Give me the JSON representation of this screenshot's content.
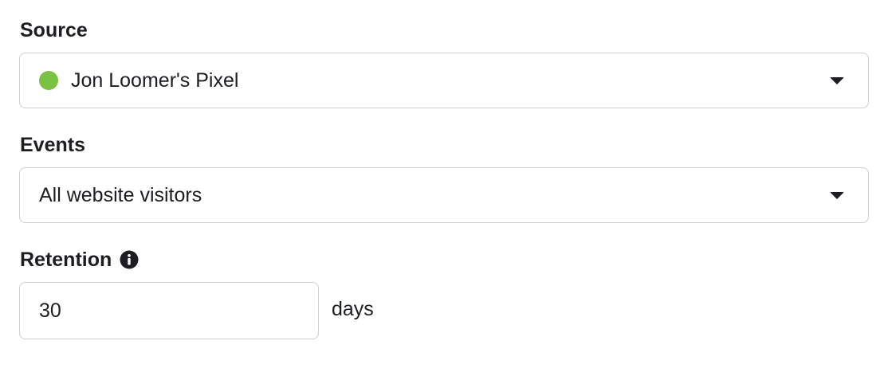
{
  "source": {
    "label": "Source",
    "selected": "Jon Loomer's Pixel",
    "status_color": "#7bc142",
    "status_icon": "green-status-dot"
  },
  "events": {
    "label": "Events",
    "selected": "All website visitors"
  },
  "retention": {
    "label": "Retention",
    "info_icon": "info-icon",
    "value": "30",
    "unit": "days"
  },
  "colors": {
    "text": "#1c1e21",
    "border": "#ccd0d5",
    "status_green": "#7bc142"
  }
}
